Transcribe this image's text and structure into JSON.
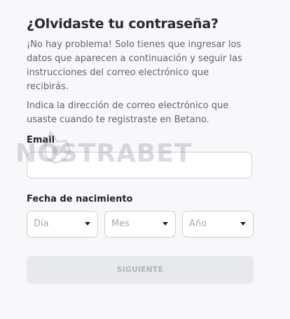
{
  "title": "¿Olvidaste tu contraseña?",
  "intro": "¡No hay problema! Solo tienes que ingresar los datos que aparecen a continuación y seguir las instrucciones del correo electrónico que recibirás.",
  "hint": "Indica la dirección de correo electrónico que usaste cuando te registraste en Betano.",
  "email": {
    "label": "Email",
    "value": "",
    "placeholder": ""
  },
  "birth_date": {
    "label": "Fecha de nacimiento",
    "day": {
      "selected": "Día",
      "icon": "chevron-down-icon"
    },
    "month": {
      "selected": "Mes",
      "icon": "chevron-down-icon"
    },
    "year": {
      "selected": "Año",
      "icon": "chevron-down-icon"
    }
  },
  "submit_label": "SIGUIENTE",
  "watermark": "NOSTRABET",
  "colors": {
    "background": "#f8f8fa",
    "text_primary": "#1f2430",
    "text_secondary": "#5d6472",
    "border": "#cdd0d7",
    "button_disabled_bg": "#e8e9ed",
    "button_disabled_text": "#aeb2ba"
  }
}
